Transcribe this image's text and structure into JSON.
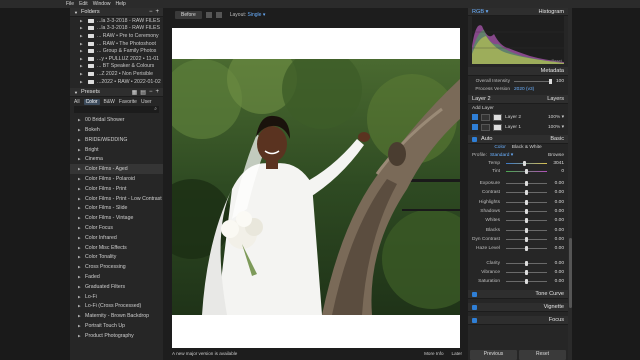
{
  "menubar": [
    "File",
    "Edit",
    "Window",
    "Help"
  ],
  "folders": {
    "title": "Folders",
    "items": [
      "...la 3-3-2018 - RAW FILES",
      "...la 3-3-2018 - RAW FILES",
      "... RAW • Pre to Ceremony",
      "... RAW • The Photoshoot",
      "... Group & Family Photos",
      "...y • PULLUZ 2022 • 11-01",
      "... BT Speaker & Colours",
      "...Z 2022 • Non Perisible",
      "...2022 • RAW • 2022-01-02"
    ]
  },
  "presets": {
    "title": "Presets",
    "tabs": [
      "All",
      "Color",
      "B&W",
      "Favorite",
      "User"
    ],
    "active_tab": "Color",
    "items": [
      "00 Bridal Shower",
      "Bokeh",
      "BRIDE/WEDDING",
      "Bright",
      "Cinema",
      "Color Films - Aged",
      "Color Films - Polaroid",
      "Color Films - Print",
      "Color Films - Print - Low Contrast",
      "Color Films - Slide",
      "Color Films - Vintage",
      "Color Focus",
      "Color Infrared",
      "Color Misc Effects",
      "Color Tonality",
      "Cross Processing",
      "Faded",
      "Graduated Filters",
      "Lo-Fi",
      "Lo-Fi (Cross Processed)",
      "Maternity - Brown Backdrop",
      "Portrait Touch Up",
      "Product Photography"
    ],
    "highlighted_index": 5
  },
  "toolbar": {
    "before_label": "Before",
    "layout_label": "Layout:",
    "layout_value": "Single ▾"
  },
  "status": {
    "message": "A new major version is available",
    "more_info": "More Info",
    "later": "Later"
  },
  "histogram": {
    "title": "Histogram",
    "mode": "RGB ▾",
    "reset": "Reset"
  },
  "metadata": {
    "title": "Metadata",
    "intensity_label": "Overall Intensity",
    "intensity_value": "100",
    "process_label": "Process Version",
    "process_value": "2020 (v3)"
  },
  "layers": {
    "layer_label": "Layer 2",
    "title": "Layers",
    "add_layer": "Add Layer",
    "items": [
      {
        "name": "Layer 2",
        "opacity": "100% ▾"
      },
      {
        "name": "Layer 1",
        "opacity": "100% ▾"
      }
    ]
  },
  "basic": {
    "auto": "Auto",
    "title": "Basic",
    "color_tab": "Color",
    "bw_tab": "Black & White",
    "profile_label": "Profile:",
    "profile_value": "Standard ▾",
    "browse": "Browse",
    "temp_label": "Temp",
    "temp_value": "3041",
    "temp_pos": 0.45,
    "tint_label": "Tint",
    "tint_value": "0",
    "tint_pos": 0.5,
    "sliders": [
      {
        "label": "Exposure",
        "value": "0.00",
        "pos": 0.5
      },
      {
        "label": "Contrast",
        "value": "0.00",
        "pos": 0.5
      },
      {
        "label": "Highlights",
        "value": "0.00",
        "pos": 0.5
      },
      {
        "label": "Shadows",
        "value": "0.00",
        "pos": 0.5
      },
      {
        "label": "Whites",
        "value": "0.00",
        "pos": 0.5
      },
      {
        "label": "Blacks",
        "value": "0.00",
        "pos": 0.5
      },
      {
        "label": "Dyn Contrast",
        "value": "0.00",
        "pos": 0.5
      },
      {
        "label": "Haze Level",
        "value": "0.00",
        "pos": 0.5
      },
      {
        "label": "Clarity",
        "value": "0.00",
        "pos": 0.5
      },
      {
        "label": "Vibrance",
        "value": "0.00",
        "pos": 0.5
      },
      {
        "label": "Saturation",
        "value": "0.00",
        "pos": 0.5
      }
    ]
  },
  "collapsed_panels": [
    "Tone Curve",
    "Vignette",
    "Focus"
  ],
  "bottom_buttons": {
    "previous": "Previous",
    "reset": "Reset"
  },
  "colors": {
    "accent": "#2f7fd6",
    "link": "#6ab0ff",
    "panel": "#262626",
    "canvas": "#ffffff"
  }
}
